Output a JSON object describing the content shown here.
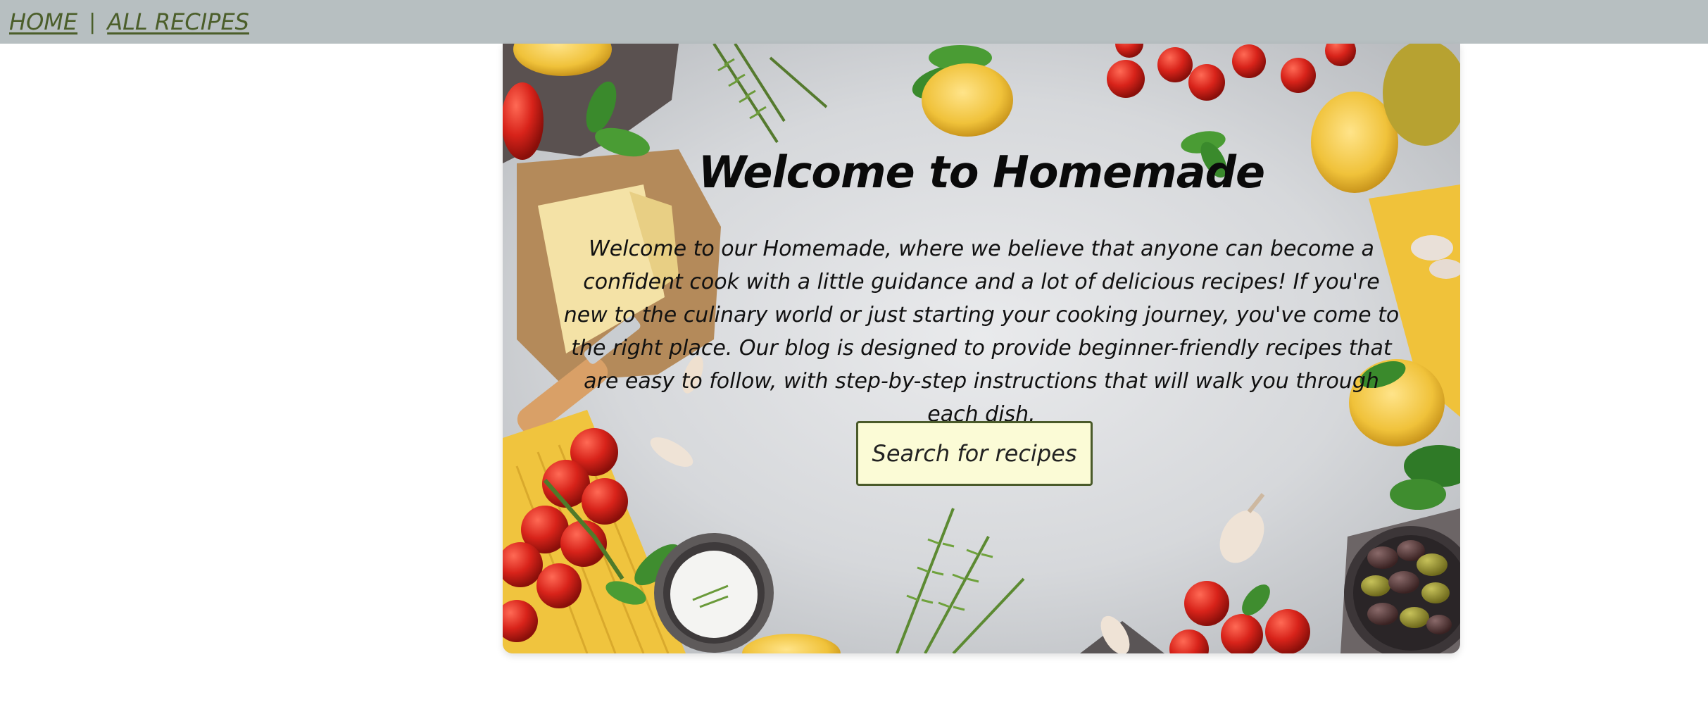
{
  "nav": {
    "home_label": "HOME",
    "separator": "|",
    "all_recipes_label": "ALL RECIPES"
  },
  "hero": {
    "title": "Welcome to Homemade",
    "intro": "Welcome to our Homemade, where we believe that anyone can become a confident cook with a little guidance and a lot of delicious recipes! If you're new to the culinary world or just starting your cooking journey, you've come to the right place. Our blog is designed to provide beginner-friendly recipes that are easy to follow, with step-by-step instructions that will walk you through each dish.",
    "search_button_label": "Search for recipes",
    "background_image": "food-ingredients-background"
  },
  "colors": {
    "nav_background": "#b7bfc1",
    "nav_link": "#4b5e2a",
    "button_background": "#fbfbd6",
    "button_border": "#4a5a2a"
  }
}
